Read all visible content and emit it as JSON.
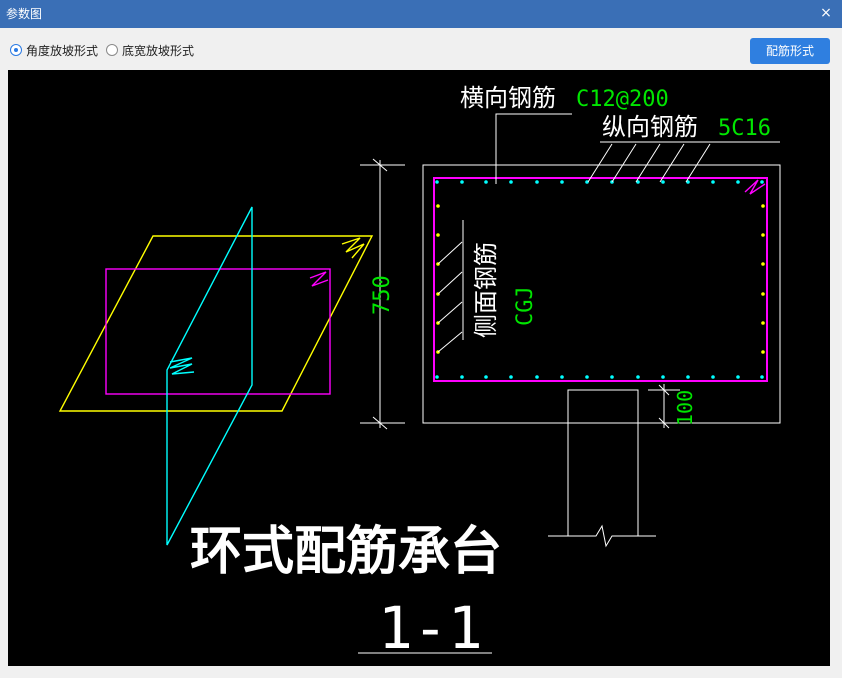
{
  "window": {
    "title": "参数图",
    "close_glyph": "×"
  },
  "options": {
    "radio_angle": {
      "label": "角度放坡形式",
      "checked": true
    },
    "radio_width": {
      "label": "底宽放坡形式",
      "checked": false
    }
  },
  "toolbar": {
    "rebar_button": "配筋形式"
  },
  "drawing": {
    "transverse_label": "横向钢筋",
    "transverse_value": "C12@200",
    "longitudinal_label": "纵向钢筋",
    "longitudinal_value": "5C16",
    "side_label": "侧面钢筋",
    "side_value": "CGJ",
    "height_dim": "750",
    "cover_dim": "100",
    "main_title": "环式配筋承台",
    "section_label": "1-1"
  },
  "colors": {
    "titlebar": "#3a6fb6",
    "button": "#2f7fe0",
    "white": "#ffffff",
    "green": "#00e600",
    "yellow": "#ffff00",
    "magenta": "#ff00ff",
    "cyan": "#00ffff"
  }
}
